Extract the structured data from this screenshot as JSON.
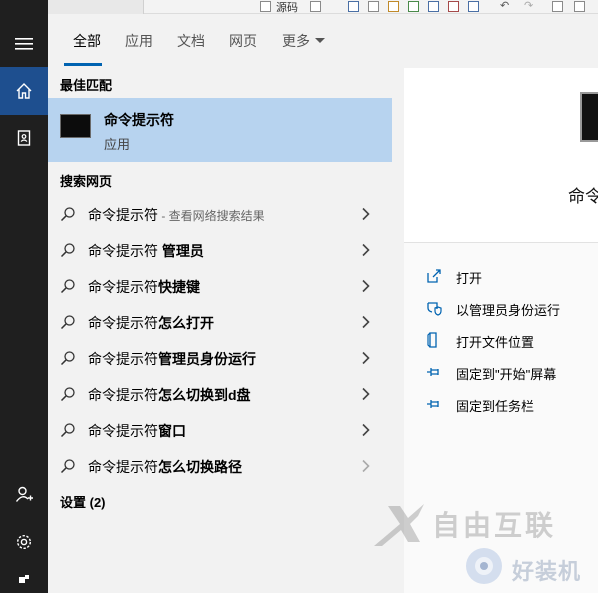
{
  "toolbar_bg": {
    "source_label": "源码"
  },
  "tabs": [
    {
      "label": "全部",
      "active": true
    },
    {
      "label": "应用",
      "active": false
    },
    {
      "label": "文档",
      "active": false
    },
    {
      "label": "网页",
      "active": false
    },
    {
      "label": "更多",
      "active": false
    }
  ],
  "sections": {
    "best_match": "最佳匹配",
    "search_web": "搜索网页",
    "settings": "设置 (2)"
  },
  "best_match": {
    "title": "命令提示符",
    "subtitle": "应用"
  },
  "web_results": [
    {
      "base": "命令提示符",
      "bold": "",
      "hint": " - 查看网络搜索结果"
    },
    {
      "base": "命令提示符 ",
      "bold": "管理员",
      "hint": ""
    },
    {
      "base": "命令提示符",
      "bold": "快捷键",
      "hint": ""
    },
    {
      "base": "命令提示符",
      "bold": "怎么打开",
      "hint": ""
    },
    {
      "base": "命令提示符",
      "bold": "管理员身份运行",
      "hint": ""
    },
    {
      "base": "命令提示符",
      "bold": "怎么切换到d盘",
      "hint": ""
    },
    {
      "base": "命令提示符",
      "bold": "窗口",
      "hint": ""
    },
    {
      "base": "命令提示符",
      "bold": "怎么切换路径",
      "hint": ""
    }
  ],
  "preview": {
    "title": "命令",
    "actions": [
      {
        "label": "打开",
        "icon": "open-icon"
      },
      {
        "label": "以管理员身份运行",
        "icon": "shield-icon"
      },
      {
        "label": "打开文件位置",
        "icon": "file-location-icon"
      },
      {
        "label": "固定到\"开始\"屏幕",
        "icon": "pin-icon"
      },
      {
        "label": "固定到任务栏",
        "icon": "pin-icon"
      }
    ]
  },
  "watermark": {
    "brand": "自由互联",
    "brand2": "好装机"
  },
  "colors": {
    "selected_bg": "#b7d3ef",
    "accent": "#0063b1",
    "rail_bg": "#1f1f1f"
  }
}
